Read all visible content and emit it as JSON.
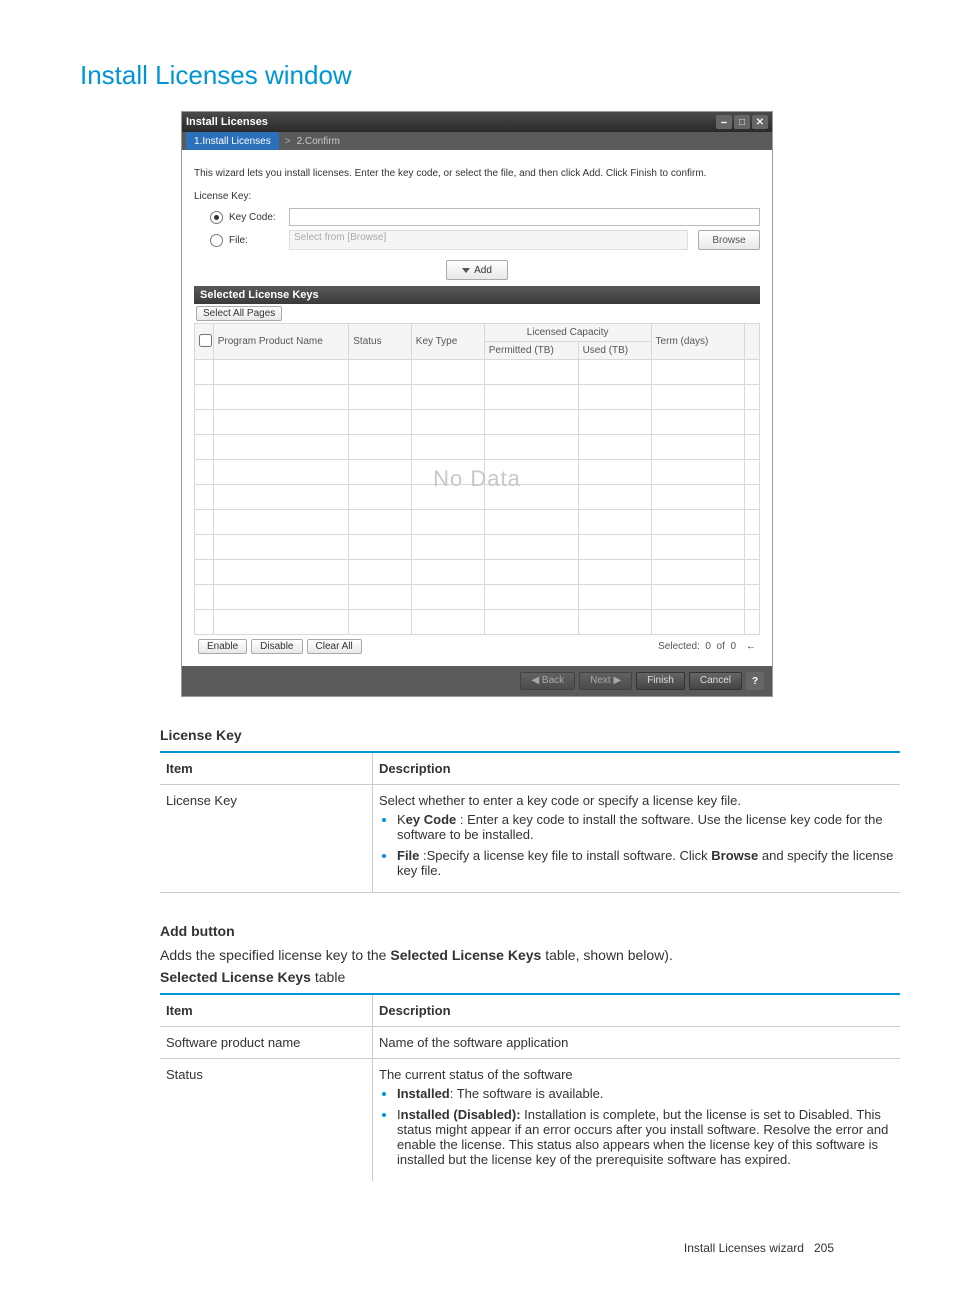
{
  "page_title": "Install Licenses window",
  "screenshot": {
    "title": "Install Licenses",
    "step1": "1.Install Licenses",
    "step_sep": ">",
    "step2": "2.Confirm",
    "instruction": "This wizard lets you install licenses. Enter the key code, or select the file, and then click Add. Click Finish to confirm.",
    "license_key_label": "License Key:",
    "radio_key_code": "Key Code:",
    "radio_file": "File:",
    "file_placeholder": "Select from [Browse]",
    "browse_btn": "Browse",
    "add_btn": "Add",
    "section_title": "Selected License Keys",
    "select_all_pages": "Select All Pages",
    "col_checkbox": "",
    "col_product": "Program Product Name",
    "col_status": "Status",
    "col_key_type": "Key Type",
    "col_capacity_group": "Licensed Capacity",
    "col_permitted": "Permitted (TB)",
    "col_used": "Used (TB)",
    "col_term": "Term (days)",
    "no_data": "No Data",
    "btn_enable": "Enable",
    "btn_disable": "Disable",
    "btn_clear_all": "Clear All",
    "selected_label": "Selected:",
    "selected_count": "0",
    "selected_of": "of",
    "selected_total": "0",
    "btn_back": "◀ Back",
    "btn_next": "Next ▶",
    "btn_finish": "Finish",
    "btn_cancel": "Cancel",
    "help": "?"
  },
  "license_key_section": {
    "heading": "License Key",
    "th_item": "Item",
    "th_desc": "Description",
    "row_item": "License Key",
    "row_desc_intro": "Select whether to enter a key code or specify a license key file.",
    "bullet1_bold": "Key Code",
    "bullet1_rest": " : Enter a key code to install the software. Use the license key code for the software to be installed.",
    "bullet2_bold": "File",
    "bullet2_rest": " :Specify a license key file to install software. Click ",
    "bullet2_bold2": "Browse",
    "bullet2_rest2": " and specify the license key file."
  },
  "add_button_section": {
    "heading": "Add button",
    "para1a": "Adds the specified license key to the ",
    "para1b": "Selected License Keys",
    "para1c": " table, shown below).",
    "heading2a": "Selected License Keys",
    "heading2b": " table"
  },
  "slk_table": {
    "th_item": "Item",
    "th_desc": "Description",
    "row1_item": "Software product name",
    "row1_desc": "Name of the software application",
    "row2_item": "Status",
    "row2_desc_intro": "The current status of the software",
    "row2_b1_bold": "Installed",
    "row2_b1_rest": ": The software is available.",
    "row2_b2_bold": "Installed (Disabled):",
    "row2_b2_rest": " Installation is complete, but the license is set to Disabled. This status might appear if an error occurs after you install software. Resolve the error and enable the license. This status also appears when the license key of this software is installed but the license key of the prerequisite software has expired."
  },
  "footer": {
    "text": "Install Licenses wizard",
    "page": "205"
  }
}
